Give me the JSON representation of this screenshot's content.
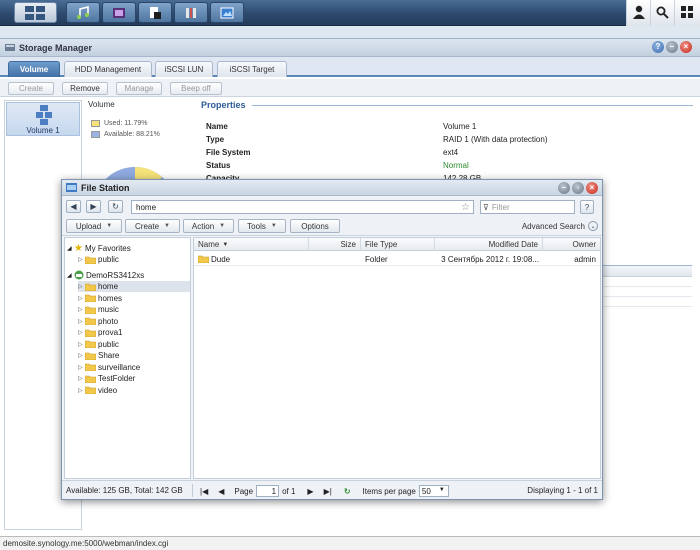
{
  "taskbar": {
    "icons": [
      "main-menu-icon",
      "music-icon",
      "video-icon",
      "document-icon",
      "book-icon",
      "photo-icon"
    ],
    "right_icons": [
      "user-icon",
      "search-icon",
      "widgets-icon"
    ]
  },
  "storage_manager": {
    "title": "Storage Manager",
    "tabs": [
      "Volume",
      "HDD Management",
      "iSCSI LUN",
      "iSCSI Target"
    ],
    "toolbar": [
      "Create",
      "Remove",
      "Manage",
      "Beep off"
    ],
    "volume_item": "Volume 1",
    "volume_header": "Volume",
    "usage": {
      "used": "Used: 11.79%",
      "available": "Available: 88.21%",
      "used_fraction": 0.1179
    },
    "properties_title": "Properties",
    "properties": [
      {
        "key": "Name",
        "value": "Volume 1"
      },
      {
        "key": "Type",
        "value": "RAID 1 (With data protection)"
      },
      {
        "key": "File System",
        "value": "ext4"
      },
      {
        "key": "Status",
        "value": "Normal"
      },
      {
        "key": "Capacity",
        "value": "142.28 GB"
      }
    ]
  },
  "file_station": {
    "title": "File Station",
    "path": "home",
    "filter_placeholder": "Filter",
    "toolbar": [
      "Upload",
      "Create",
      "Action",
      "Tools",
      "Options"
    ],
    "advanced_search": "Advanced Search",
    "tree": {
      "favorites": "My Favorites",
      "favorites_children": [
        "public"
      ],
      "server": "DemoRS3412xs",
      "server_children": [
        "home",
        "homes",
        "music",
        "photo",
        "prova1",
        "public",
        "Share",
        "surveillance",
        "TestFolder",
        "video"
      ]
    },
    "columns": [
      "Name",
      "Size",
      "File Type",
      "Modified Date",
      "Owner"
    ],
    "rows": [
      {
        "name": "Dude",
        "size": "",
        "type": "Folder",
        "modified": "3 Сентябрь 2012 г. 19:08...",
        "owner": "admin"
      }
    ],
    "available": "Available: 125 GB, Total: 142 GB",
    "paging": {
      "page_label": "Page",
      "page": "1",
      "of": "of 1",
      "items_label": "Items per page",
      "items": "50",
      "displaying": "Displaying 1 - 1 of 1"
    }
  },
  "status_url": "demosite.synology.me:5000/webman/index.cgi",
  "colors": {
    "accent": "#3f6fa6",
    "used": "#f5e27a",
    "available": "#9bb2e3",
    "normal": "#2e8b2e"
  }
}
